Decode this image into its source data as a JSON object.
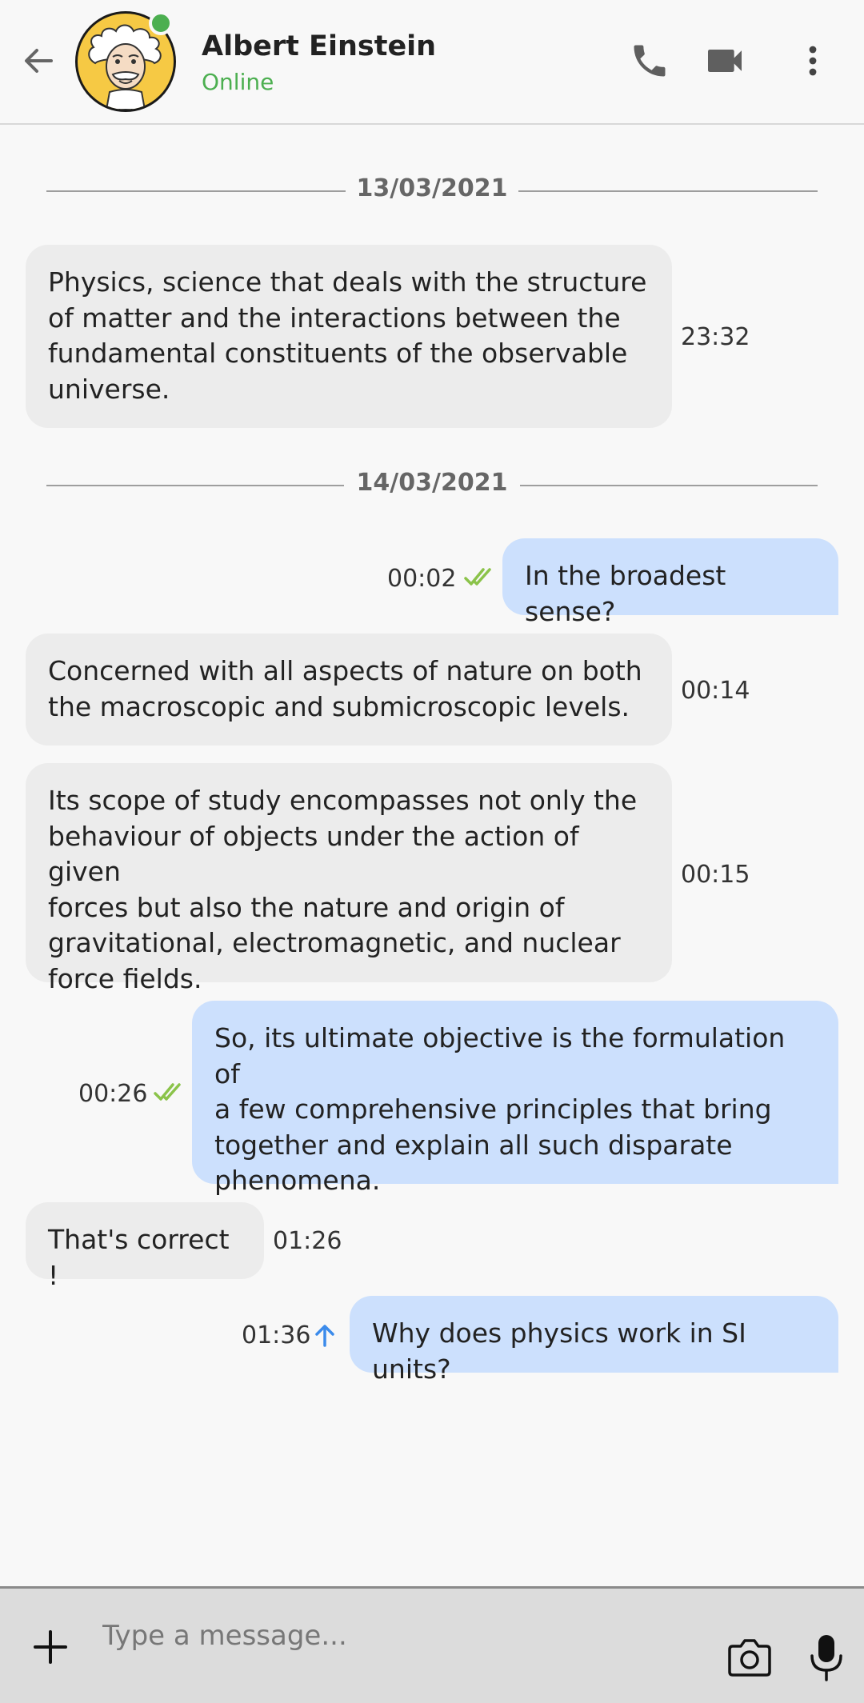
{
  "header": {
    "contact_name": "Albert Einstein",
    "status": "Online"
  },
  "colors": {
    "incoming_bubble": "#ececec",
    "outgoing_bubble": "#cce0fd",
    "online": "#4caf50",
    "read_tick": "#8bc34a",
    "sending_arrow": "#3b8beb"
  },
  "conversation": {
    "dates": [
      "13/03/2021",
      "14/03/2021"
    ],
    "messages": [
      {
        "direction": "incoming",
        "lines": [
          "Physics, science that deals with the structure",
          "of matter and the interactions between the",
          "fundamental constituents of the observable",
          "universe."
        ],
        "time": "23:32"
      },
      {
        "direction": "outgoing",
        "lines": [
          "In the broadest sense?"
        ],
        "time": "00:02",
        "status": "read"
      },
      {
        "direction": "incoming",
        "lines": [
          "Concerned with all aspects of nature on both",
          "the macroscopic and submicroscopic levels."
        ],
        "time": "00:14"
      },
      {
        "direction": "incoming",
        "lines": [
          "Its scope of study encompasses not only the",
          "behaviour of objects under the action of given",
          "forces but also the nature and origin of",
          "gravitational, electromagnetic, and nuclear",
          "force fields."
        ],
        "time": "00:15"
      },
      {
        "direction": "outgoing",
        "lines": [
          "So, its ultimate objective is the formulation of",
          "a few comprehensive principles that bring",
          "together and explain all such disparate",
          "phenomena."
        ],
        "time": "00:26",
        "status": "read"
      },
      {
        "direction": "incoming",
        "lines": [
          "That's correct !"
        ],
        "time": "01:26"
      },
      {
        "direction": "outgoing",
        "lines": [
          "Why does physics work in SI units?"
        ],
        "time": "01:36",
        "status": "sending"
      }
    ]
  },
  "composer": {
    "placeholder": "Type a message..."
  },
  "icons": {
    "back": "arrow-left-icon",
    "call": "phone-icon",
    "video": "video-camera-icon",
    "menu": "more-vertical-icon",
    "attach": "plus-icon",
    "camera": "camera-icon",
    "mic": "microphone-icon",
    "read": "double-check-icon",
    "sending": "arrow-up-icon"
  }
}
